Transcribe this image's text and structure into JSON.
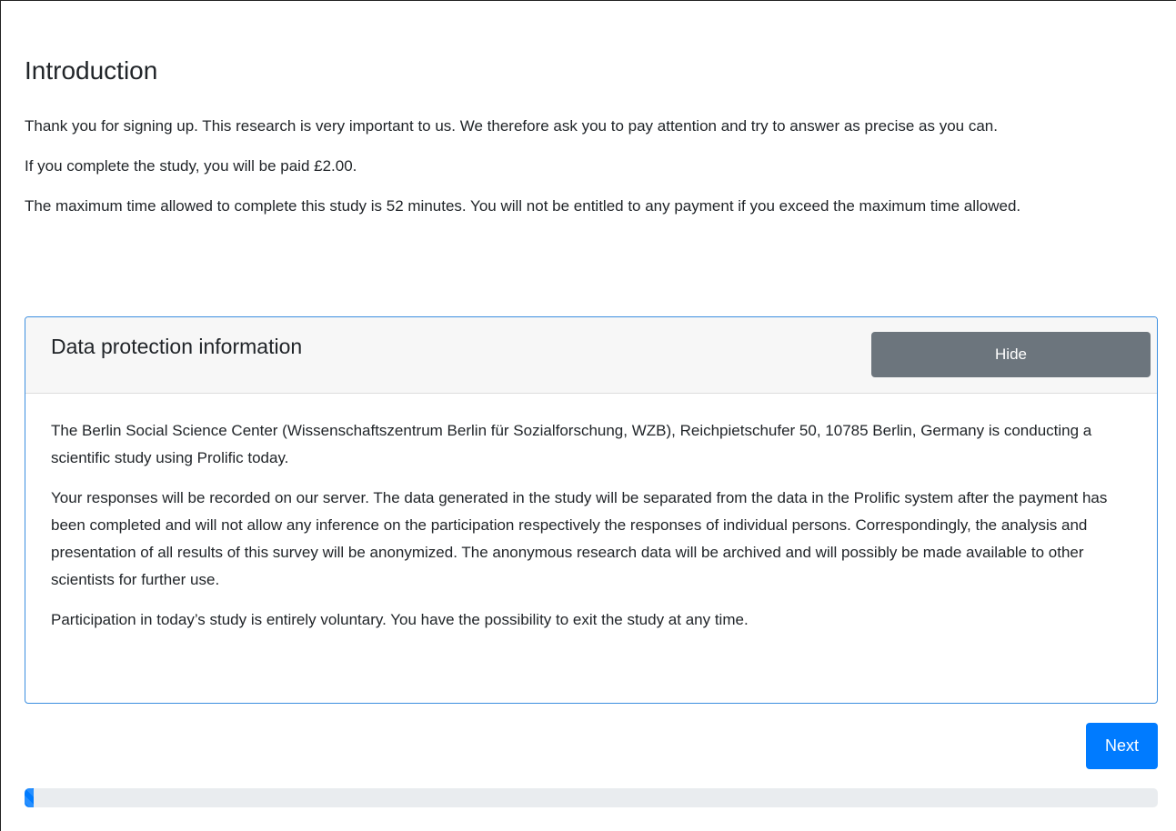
{
  "page": {
    "title": "Introduction",
    "paragraphs": [
      "Thank you for signing up. This research is very important to us. We therefore ask you to pay attention and try to answer as precise as you can.",
      "If you complete the study, you will be paid £2.00.",
      "The maximum time allowed to complete this study is 52 minutes. You will not be entitled to any payment if you exceed the maximum time allowed."
    ]
  },
  "data_protection": {
    "title": "Data protection information",
    "hide_label": "Hide",
    "paragraphs": [
      "The Berlin Social Science Center (Wissenschaftszentrum Berlin für Sozialforschung, WZB), Reichpietschufer 50, 10785 Berlin, Germany is conducting a scientific study using Prolific today.",
      "Your responses will be recorded on our server. The data generated in the study will be separated from the data in the Prolific system after the payment has been completed and will not allow any inference on the participation respectively the responses of individual persons. Correspondingly, the analysis and presentation of all results of this survey will be anonymized. The anonymous research data will be archived and will possibly be made available to other scientists for further use.",
      "Participation in today’s study is entirely voluntary. You have the possibility to exit the study at any time."
    ]
  },
  "navigation": {
    "next_label": "Next"
  },
  "progress": {
    "value_fraction": 0.008,
    "bar_color": "#007bff",
    "track_color": "#e9ecef"
  },
  "colors": {
    "primary": "#007bff",
    "secondary": "#6c757d",
    "card_border": "#3d8fe0"
  }
}
